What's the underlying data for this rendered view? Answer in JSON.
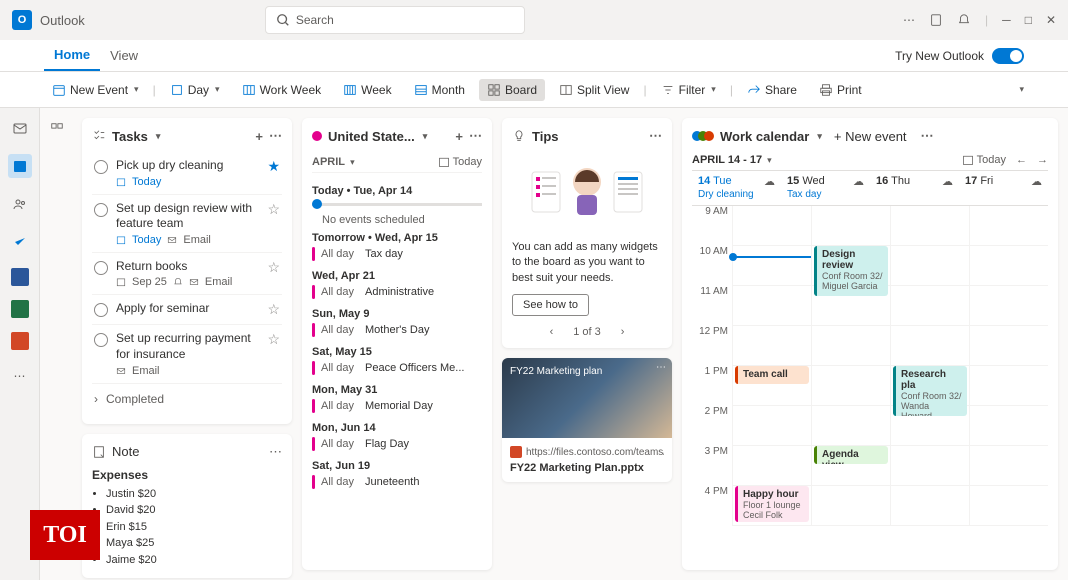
{
  "app": {
    "name": "Outlook"
  },
  "search": {
    "placeholder": "Search"
  },
  "tabs": {
    "home": "Home",
    "view": "View"
  },
  "tryNew": "Try New Outlook",
  "ribbon": {
    "newEvent": "New Event",
    "day": "Day",
    "workWeek": "Work Week",
    "week": "Week",
    "month": "Month",
    "board": "Board",
    "splitView": "Split View",
    "filter": "Filter",
    "share": "Share",
    "print": "Print"
  },
  "tasksCard": {
    "title": "Tasks",
    "items": [
      {
        "title": "Pick up dry cleaning",
        "meta": "Today",
        "metaIsToday": true,
        "starred": true
      },
      {
        "title": "Set up design review with feature team",
        "meta": "Today",
        "metaIsToday": true,
        "email": true,
        "starred": false
      },
      {
        "title": "Return books",
        "meta": "Sep 25",
        "bell": true,
        "email": true,
        "starred": false
      },
      {
        "title": "Apply for seminar",
        "meta": "",
        "starred": false
      },
      {
        "title": "Set up recurring payment for insurance",
        "email": true,
        "emailLabel": "Email",
        "starred": false
      }
    ],
    "completed": "Completed"
  },
  "noteCard": {
    "header": "Note",
    "title": "Expenses",
    "items": [
      "Justin $20",
      "David $20",
      "Erin $15",
      "Maya $25",
      "Jaime $20"
    ]
  },
  "holidayCal": {
    "title": "United State...",
    "month": "APRIL",
    "todayBtn": "Today",
    "today": {
      "label": "Today  •  Tue, Apr 14",
      "empty": "No events scheduled"
    },
    "days": [
      {
        "header": "Tomorrow  •  Wed, Apr 15",
        "events": [
          {
            "allday": "All day",
            "title": "Tax day"
          }
        ]
      },
      {
        "header": "Wed, Apr 21",
        "events": [
          {
            "allday": "All day",
            "title": "Administrative"
          }
        ]
      },
      {
        "header": "Sun, May 9",
        "events": [
          {
            "allday": "All day",
            "title": "Mother's Day"
          }
        ]
      },
      {
        "header": "Sat, May 15",
        "events": [
          {
            "allday": "All day",
            "title": "Peace Officers Me..."
          }
        ]
      },
      {
        "header": "Mon, May 31",
        "events": [
          {
            "allday": "All day",
            "title": "Memorial Day"
          }
        ]
      },
      {
        "header": "Mon, Jun 14",
        "events": [
          {
            "allday": "All day",
            "title": "Flag Day"
          }
        ]
      },
      {
        "header": "Sat, Jun 19",
        "events": [
          {
            "allday": "All day",
            "title": "Juneteenth"
          }
        ]
      }
    ]
  },
  "tips": {
    "title": "Tips",
    "text": "You can add as many widgets to the board as you want to best suit your needs.",
    "cta": "See how to",
    "pager": "1 of 3"
  },
  "fileCard": {
    "thumbTitle": "FY22 Marketing plan",
    "url": "https://files.contoso.com/teams/...",
    "name": "FY22 Marketing Plan.pptx"
  },
  "workCal": {
    "title": "Work calendar",
    "newEvent": "New event",
    "range": "APRIL 14 - 17",
    "todayBtn": "Today",
    "days": [
      {
        "num": "14",
        "dow": "Tue",
        "allday": "Dry cleaning",
        "today": true
      },
      {
        "num": "15",
        "dow": "Wed",
        "allday": "Tax day"
      },
      {
        "num": "16",
        "dow": "Thu",
        "allday": ""
      },
      {
        "num": "17",
        "dow": "Fri",
        "allday": ""
      }
    ],
    "hours": [
      "9 AM",
      "10 AM",
      "11 AM",
      "12 PM",
      "1 PM",
      "2 PM",
      "3 PM",
      "4 PM"
    ],
    "events": {
      "teamCall": {
        "title": "Team call"
      },
      "happyHour": {
        "title": "Happy hour",
        "sub1": "Floor 1 lounge",
        "sub2": "Cecil Folk"
      },
      "designReview": {
        "title": "Design review",
        "sub1": "Conf Room 32/",
        "sub2": "Miguel Garcia"
      },
      "agendaView": {
        "title": "Agenda view"
      },
      "research": {
        "title": "Research pla",
        "sub1": "Conf Room 32/",
        "sub2": "Wanda Howard"
      }
    }
  },
  "toi": "TOI"
}
